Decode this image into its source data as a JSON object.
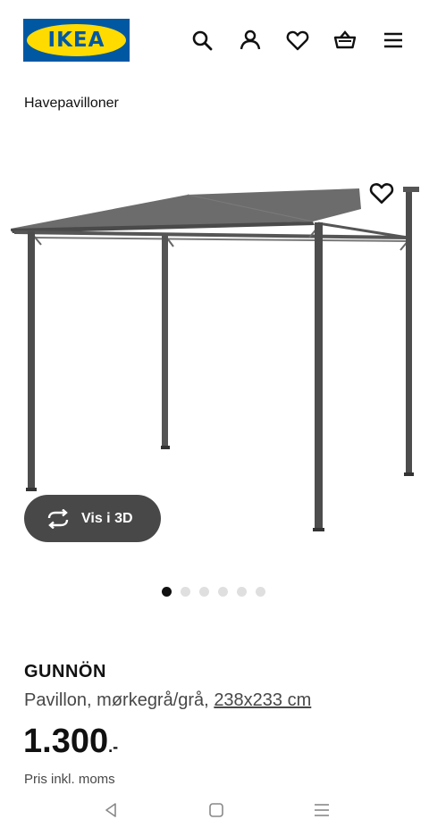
{
  "header": {
    "logo_text": "IKEA",
    "icons": [
      "search-icon",
      "user-icon",
      "heart-icon",
      "basket-icon",
      "menu-icon"
    ]
  },
  "breadcrumb": "Havepavilloner",
  "gallery": {
    "view_3d_label": "Vis i 3D",
    "dot_count": 6,
    "active_dot": 1
  },
  "product": {
    "name": "GUNNÖN",
    "description": "Pavillon, mørkegrå/grå,",
    "dimensions": "238x233 cm",
    "price_integer": "1.300",
    "price_suffix": ".-",
    "price_note": "Pris inkl. moms"
  },
  "colors": {
    "ikea_blue": "#0058a3",
    "ikea_yellow": "#ffdb00",
    "button_dark": "#484848"
  },
  "system_nav": [
    "back-icon",
    "home-icon",
    "recents-icon"
  ]
}
